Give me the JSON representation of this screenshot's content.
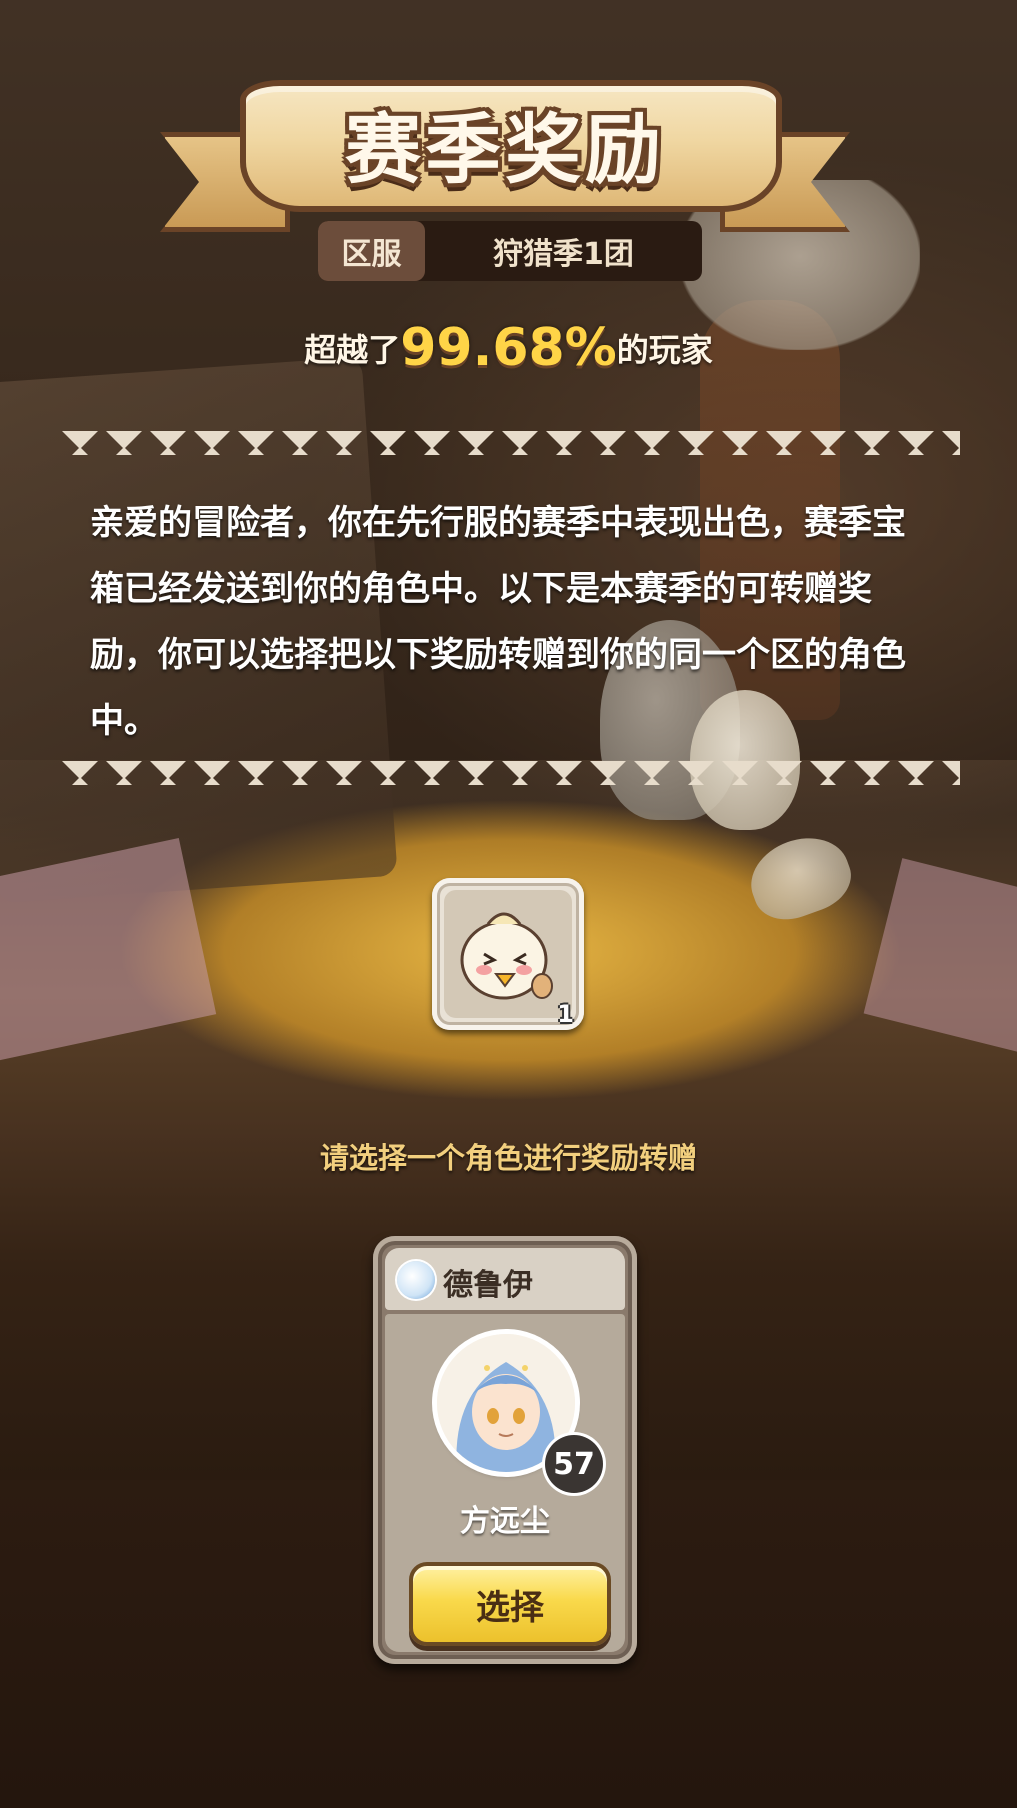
{
  "header": {
    "title": "赛季奖励"
  },
  "server": {
    "label": "区服",
    "value": "狩猎季1团"
  },
  "rank": {
    "prefix": "超越了",
    "percent": "99.68%",
    "suffix": "的玩家"
  },
  "description": "亲爱的冒险者，你在先行服的赛季中表现出色，赛季宝箱已经发送到你的角色中。以下是本赛季的可转赠奖励，你可以选择把以下奖励转赠到你的同一个区的角色中。",
  "reward": {
    "icon": "chick-mascot-icon",
    "count": "1"
  },
  "hint": "请选择一个角色进行奖励转赠",
  "character": {
    "class_icon": "druid-class-icon",
    "class_name": "德鲁伊",
    "avatar": "blue-haired-girl-avatar",
    "level": "57",
    "name": "方远尘",
    "select_label": "选择"
  },
  "colors": {
    "accent_gold": "#ffd447",
    "ribbon": "#f0d7a2",
    "button": "#f9d94b",
    "hint": "#f2cf7e"
  }
}
